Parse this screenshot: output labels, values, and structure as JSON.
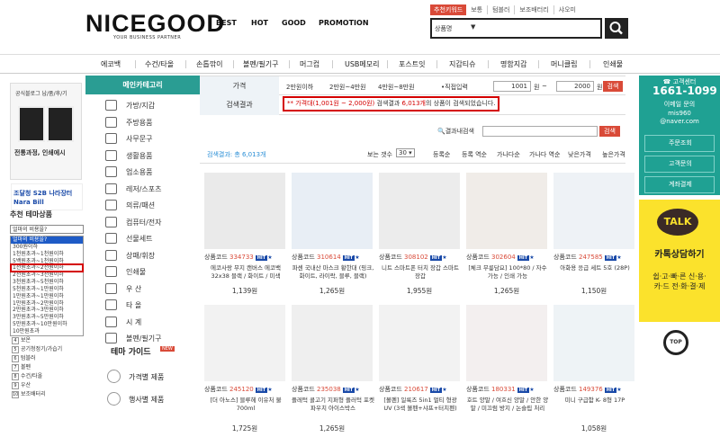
{
  "header": {
    "logo": "NICEGOOD",
    "logo_sub": "YOUR BUSINESS PARTNER",
    "gnav": [
      "BEST",
      "HOT",
      "GOOD",
      "PROMOTION"
    ],
    "top_links": {
      "keyword_btn": "추천키워드",
      "links": [
        "보통",
        "텀블러",
        "보조배터리",
        "샤오미"
      ]
    },
    "search_select": "상품명",
    "search_arrow": "▼",
    "search_icon": "search-icon"
  },
  "categories": [
    "에코백",
    "수건/타올",
    "손톱깎이",
    "볼펜/필기구",
    "머그컵",
    "USB메모리",
    "포스트잇",
    "지갑티슈",
    "명함지갑",
    "머니클립",
    "인쇄물"
  ],
  "left": {
    "blog_label": "공식블로그 납/품/후/기",
    "campaign": "전통과정, 인쇄에시",
    "gov_label": "조달청 S2B 나라장터 Nara Bill",
    "theme_title": "추천 테마상품",
    "dropdown_value": "얼마의 비용을?",
    "dropdown_options": [
      "얼마의 비용을?",
      "300원이하",
      "1천원초과~1천원이하",
      "5백원초과~1천원이하",
      "1천원초과~2천원이하",
      "2천원초과~3천원이하",
      "3천원초과~5천원이하",
      "5천원초과~1만원이하",
      "1만원초과~1만원이하",
      "1만원초과~2만원이하",
      "2만원초과~3만원이하",
      "3만원초과~5만원이하",
      "5만원초과~10만원이하",
      "10만원초과"
    ],
    "selected_index": 0,
    "boxed_index": 4,
    "numbered": [
      {
        "n": "4",
        "t": "보온"
      },
      {
        "n": "5",
        "t": "공기청정기/가습기"
      },
      {
        "n": "6",
        "t": "텀블러"
      },
      {
        "n": "7",
        "t": "볼펜"
      },
      {
        "n": "8",
        "t": "수건/타올"
      },
      {
        "n": "9",
        "t": "우산"
      },
      {
        "n": "10",
        "t": "보조배터리"
      }
    ]
  },
  "maincat": {
    "title": "메인카테고리",
    "items": [
      "가방/지갑",
      "주방용품",
      "사무문구",
      "생활용품",
      "업소용품",
      "레저/스포츠",
      "의류/패션",
      "컴퓨터/전자",
      "선물세트",
      "상패/휘장",
      "인쇄물",
      "우 산",
      "타 올",
      "시 계",
      "볼펜/필기구"
    ],
    "guide_title": "테마 가이드",
    "guide_badge": "NEW",
    "guide_items": [
      "가격별 제품",
      "행사별 제품"
    ]
  },
  "filters": {
    "price_label": "가격",
    "price_ranges": [
      "2만원이하",
      "2만원~4만원",
      "4만원~8만원"
    ],
    "direct_label": "•직접입력",
    "min": "1001",
    "max": "2000",
    "won": "원",
    "tilde": "~",
    "go_label": "검색",
    "result_label": "검색결과",
    "result_prefix": "** 가격대(1,001원 ~ 2,000원)",
    "result_mid": " 검색결과 ",
    "result_count": "6,013개",
    "result_suffix": "의 상품이 검색되었습니다.",
    "within_label": "결과내검색",
    "within_btn": "검색"
  },
  "sortbar": {
    "total": "검색결과: 총 6,013개",
    "view_label": "보는 갯수",
    "view_value": "30",
    "sorts": [
      "등록순",
      "등록 역순",
      "가나다순",
      "가나다 역순",
      "낮은가격",
      "높은가격"
    ]
  },
  "products": [
    {
      "code": "334733",
      "name": "에코사랑 무지 캔버스 에코백 32x38 블랙 / 화이트 / 미색",
      "price": "1,139원"
    },
    {
      "code": "310614",
      "name": "파센 국내산 마스크 황한대 (핑크, 화이트, 라이락, 블루, 블랙)",
      "price": "1,265원"
    },
    {
      "code": "308102",
      "name": "니트 스마트폰 터치 장갑 스마트 장갑",
      "price": "1,955원"
    },
    {
      "code": "302604",
      "name": "[체크 무릎담요] 100*80 / 자수가능 / 인쇄 가능",
      "price": "1,265원"
    },
    {
      "code": "247585",
      "name": "아화용 응급 세트 5호 (28P)",
      "price": "1,150원"
    },
    {
      "code": "245120",
      "name": "[더 아노스] 블루헤 이유처 불 700ml",
      "price": "1,725원"
    },
    {
      "code": "235038",
      "name": "플레턱 콜고기 지퍼형 플러턱 포켓 파우치 아이스박스",
      "price": "1,265원"
    },
    {
      "code": "210617",
      "name": "[볼펜] 일룩즈 5in1 멀티 형광 UV (3색 볼펜+샤프+터치펜)",
      "price": ""
    },
    {
      "code": "180331",
      "name": "호트 양말 / 여흐신 양말 / 안한 양말 / 미끄럼 방지 / 논슬립 처리",
      "price": ""
    },
    {
      "code": "149376",
      "name": "미니 구급함 K- 8형 17P",
      "price": "1,058원"
    }
  ],
  "hit_label": "HIT",
  "code_label": "상품코드",
  "right": {
    "cc_title": "고객센터",
    "phone": "1661-1099",
    "email_label": "이메일 문의",
    "email_id": "mis960",
    "email_domain": "@naver.com",
    "buttons": [
      "주문조회",
      "고객문의",
      "계좌결제"
    ],
    "talk": "TALK",
    "kakao_title": "카톡상담하기",
    "kakao_text": "쉽·고·빠·른 신·용·카·드 전·화·결·제",
    "top": "TOP"
  }
}
